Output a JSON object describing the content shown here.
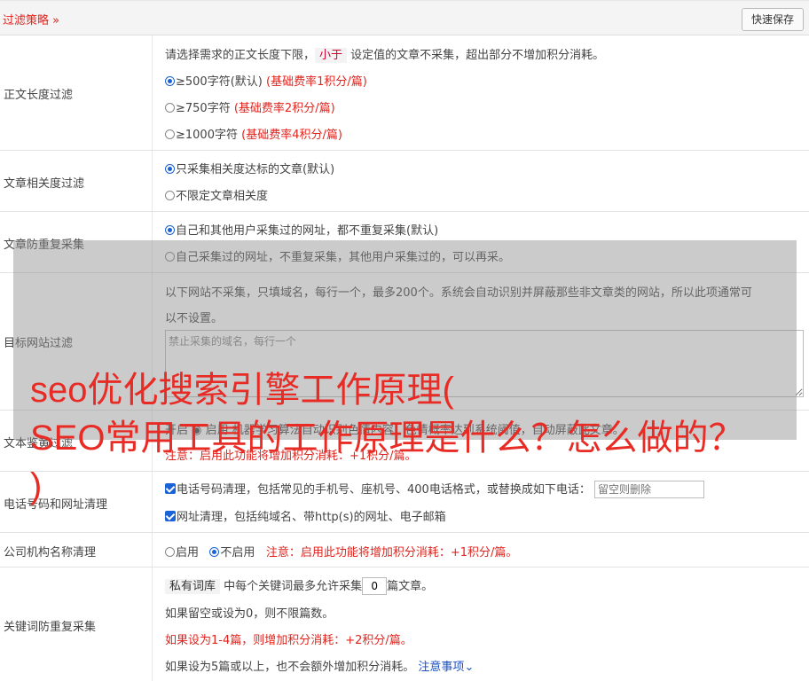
{
  "header": {
    "title": "过滤策略",
    "save_label": "快速保存"
  },
  "length_filter": {
    "label": "正文长度过滤",
    "desc_pre": "请选择需求的正文长度下限，",
    "desc_tag": "小于",
    "desc_post": "设定值的文章不采集，超出部分不增加积分消耗。",
    "options": [
      {
        "text": "≥500字符(默认)",
        "note": "(基础费率1积分/篇)",
        "selected": true
      },
      {
        "text": "≥750字符",
        "note": "(基础费率2积分/篇)",
        "selected": false
      },
      {
        "text": "≥1000字符",
        "note": "(基础费率4积分/篇)",
        "selected": false
      }
    ]
  },
  "relevance": {
    "label": "文章相关度过滤",
    "options": [
      {
        "text": "只采集相关度达标的文章(默认)",
        "selected": true
      },
      {
        "text": "不限定文章相关度",
        "selected": false
      }
    ]
  },
  "dedup": {
    "label": "文章防重复采集",
    "options": [
      {
        "text": "自己和其他用户采集过的网址，都不重复采集(默认)",
        "selected": true
      },
      {
        "text": "自己采集过的网址，不重复采集，其他用户采集过的，可以再采。",
        "selected": false
      }
    ]
  },
  "target_site": {
    "label": "目标网站过滤",
    "desc_line1": "以下网站不采集，只填域名，每行一个，最多200个。系统会自动识别并屏蔽那些非文章类的网站，所以此项通常可",
    "desc_line2": "以不设置。",
    "placeholder": "禁止采集的域名，每行一个"
  },
  "text_review": {
    "label": "文本鉴黄过滤",
    "line1": "开启 ◉ 启用 机器学习算法自动识别色情内容，色情概率达到系统阈值，自动屏蔽此文章。",
    "line2": "注意：启用此功能将增加积分消耗：+1积分/篇。"
  },
  "phone_clean": {
    "label": "电话号码和网址清理",
    "phone_text": "电话号码清理，包括常见的手机号、座机号、400电话格式，或替换成如下电话：",
    "phone_placeholder": "留空则删除",
    "url_text": "网址清理，包括纯域名、带http(s)的网址、电子邮箱"
  },
  "company": {
    "label": "公司机构名称清理",
    "on_label": "启用",
    "off_label": "不启用",
    "note": "注意：启用此功能将增加积分消耗：+1积分/篇。"
  },
  "keyword_dedup": {
    "label": "关键词防重复采集",
    "tag": "私有词库",
    "pre": "中每个关键词最多允许采集",
    "value": "0",
    "post": "篇文章。",
    "line2": "如果留空或设为0，则不限篇数。",
    "line3": "如果设为1-4篇，则增加积分消耗：+2积分/篇。",
    "line4": "如果设为5篇或以上，也不会额外增加积分消耗。",
    "link": "注意事项"
  },
  "overlay_title": {
    "line1": "seo优化搜索引擎工作原理(",
    "line2": "SEO常用工具的工作原理是什么？怎么做的？",
    "line3": ")"
  },
  "colors": {
    "accent": "#e0241e",
    "link": "#1a4fbf",
    "radio": "#1a63d6"
  }
}
